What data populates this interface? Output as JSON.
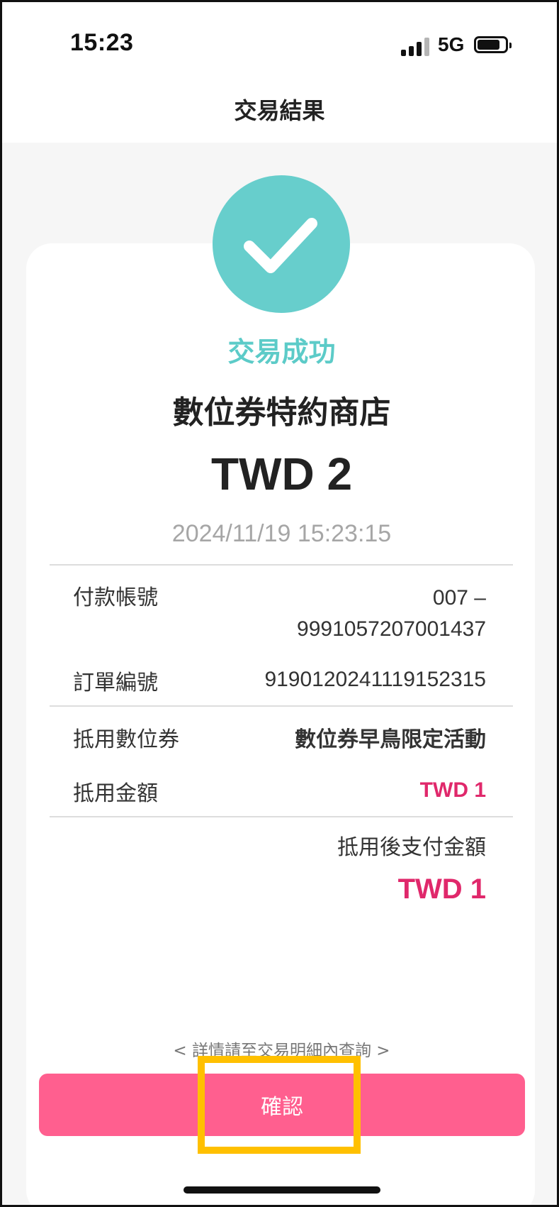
{
  "status_bar": {
    "time": "15:23",
    "network": "5G",
    "signal_bars_active": 3,
    "battery_level": 0.82
  },
  "header": {
    "title": "交易結果"
  },
  "result": {
    "status": "交易成功",
    "merchant": "數位券特約商店",
    "amount": "TWD 2",
    "datetime": "2024/11/19 15:23:15"
  },
  "details": {
    "account": {
      "label": "付款帳號",
      "value_line1": "007 –",
      "value_line2": "9991057207001437"
    },
    "order": {
      "label": "訂單編號",
      "value": "919012024111915231​5"
    },
    "voucher": {
      "label": "抵用數位券",
      "value": "數位券早鳥限定活動"
    },
    "discount": {
      "label": "抵用金額",
      "value": "TWD 1"
    }
  },
  "final": {
    "label": "抵用後支付金額",
    "amount": "TWD 1"
  },
  "hint": "< 詳情請至交易明細內查詢 >",
  "confirm": {
    "label": "確認"
  },
  "colors": {
    "accent_teal": "#67cecc",
    "amount_pink": "#e0286b",
    "button_pink": "#ff5f8f",
    "highlight": "#ffc000"
  },
  "icons": {
    "status": "check-circle-icon"
  }
}
